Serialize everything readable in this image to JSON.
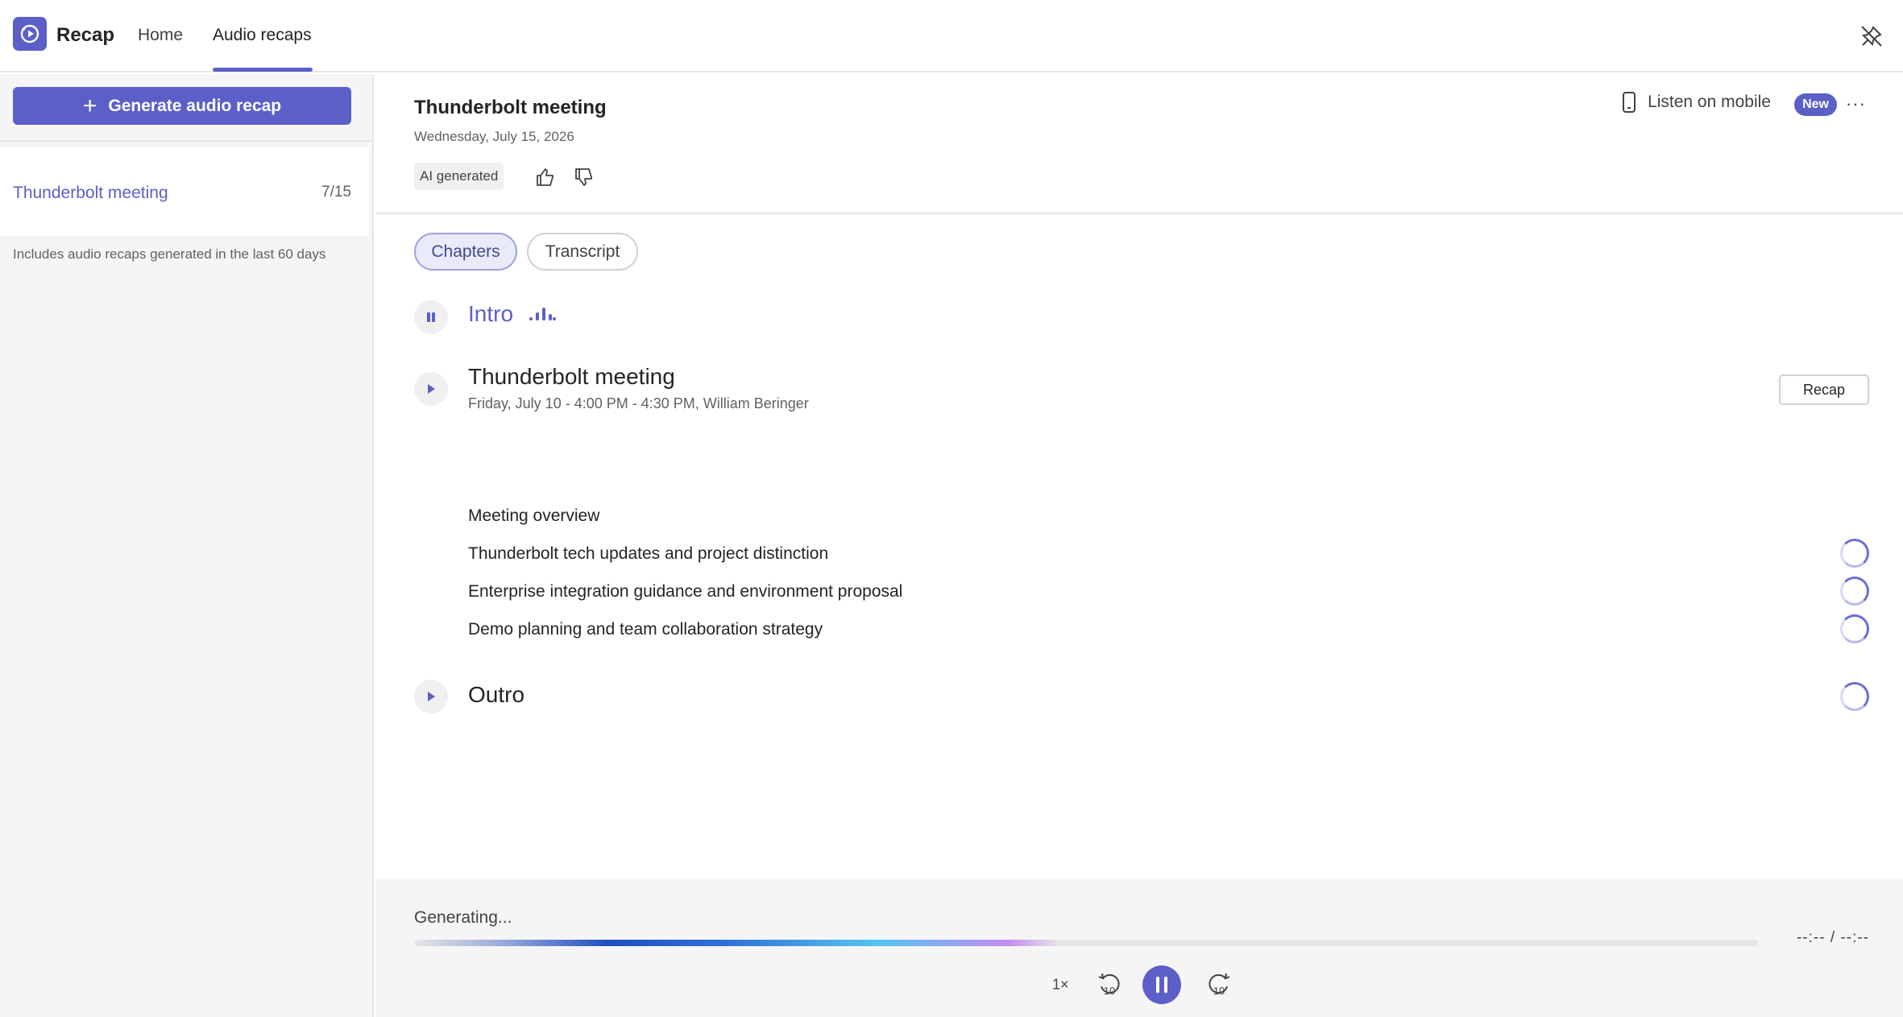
{
  "app": {
    "name": "Recap",
    "icon": "recap-play-icon",
    "accent_color": "#5b5fc7"
  },
  "nav": {
    "tabs": [
      {
        "label": "Home",
        "selected": false
      },
      {
        "label": "Audio recaps",
        "selected": true
      }
    ],
    "pin_icon": "unpin-icon"
  },
  "sidebar": {
    "generate_button": "Generate audio recap",
    "items": [
      {
        "title": "Thunderbolt meeting",
        "date": "7/15"
      }
    ],
    "note": "Includes audio recaps generated in the last 60 days"
  },
  "recap": {
    "title": "Thunderbolt meeting",
    "date": "Wednesday, July 15, 2026",
    "ai_badge": "AI generated",
    "listen_label": "Listen on mobile",
    "new_badge": "New",
    "more": "···"
  },
  "tabs": {
    "chapters": "Chapters",
    "transcript": "Transcript",
    "selected": "Chapters"
  },
  "chapters": {
    "intro": {
      "title": "Intro",
      "state": "playing"
    },
    "meeting": {
      "title": "Thunderbolt meeting",
      "subtitle": "Friday, July 10 - 4:00 PM - 4:30 PM, William Beringer",
      "recap_button": "Recap",
      "items": [
        {
          "label": "Meeting overview",
          "loading": false
        },
        {
          "label": "Thunderbolt tech updates and project distinction",
          "loading": true
        },
        {
          "label": "Enterprise integration guidance and environment proposal",
          "loading": true
        },
        {
          "label": "Demo planning and team collaboration strategy",
          "loading": true
        }
      ]
    },
    "outro": {
      "title": "Outro",
      "loading": true
    }
  },
  "player": {
    "status": "Generating...",
    "time": "--:-- / --:--",
    "speed": "1×",
    "skip_seconds": "10",
    "progress_fraction": 0.48,
    "state": "playing"
  }
}
